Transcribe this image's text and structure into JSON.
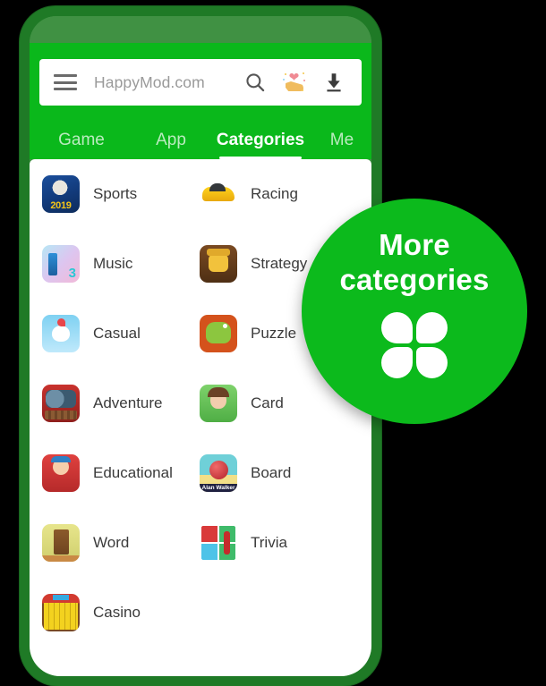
{
  "app": {
    "site_name": "HappyMod.com",
    "accent_green": "#0ab81b",
    "frame_green": "#1f7a26",
    "badge_green": "#0cba1c"
  },
  "searchbar": {
    "menu_icon": "hamburger-menu-icon",
    "title": "HappyMod.com",
    "search_icon": "search-icon",
    "favorites_icon": "hand-holding-heart-icon",
    "downloads_icon": "download-icon"
  },
  "tabs": [
    {
      "label": "Game",
      "active": false
    },
    {
      "label": "App",
      "active": false
    },
    {
      "label": "Categories",
      "active": true
    },
    {
      "label": "Me",
      "active": false
    }
  ],
  "categories": {
    "left": [
      {
        "label": "Sports",
        "icon": "sports-game-icon"
      },
      {
        "label": "Music",
        "icon": "music-game-icon"
      },
      {
        "label": "Casual",
        "icon": "casual-game-icon"
      },
      {
        "label": "Adventure",
        "icon": "adventure-game-icon"
      },
      {
        "label": "Educational",
        "icon": "educational-game-icon"
      },
      {
        "label": "Word",
        "icon": "word-game-icon"
      },
      {
        "label": "Casino",
        "icon": "casino-game-icon"
      }
    ],
    "right": [
      {
        "label": "Racing",
        "icon": "racing-game-icon"
      },
      {
        "label": "Strategy",
        "icon": "strategy-game-icon"
      },
      {
        "label": "Puzzle",
        "icon": "puzzle-game-icon"
      },
      {
        "label": "Card",
        "icon": "card-game-icon"
      },
      {
        "label": "Board",
        "icon": "board-game-icon"
      },
      {
        "label": "Trivia",
        "icon": "trivia-game-icon"
      }
    ]
  },
  "badge": {
    "line1": "More",
    "line2": "categories",
    "icon": "four-petal-grid-icon"
  }
}
